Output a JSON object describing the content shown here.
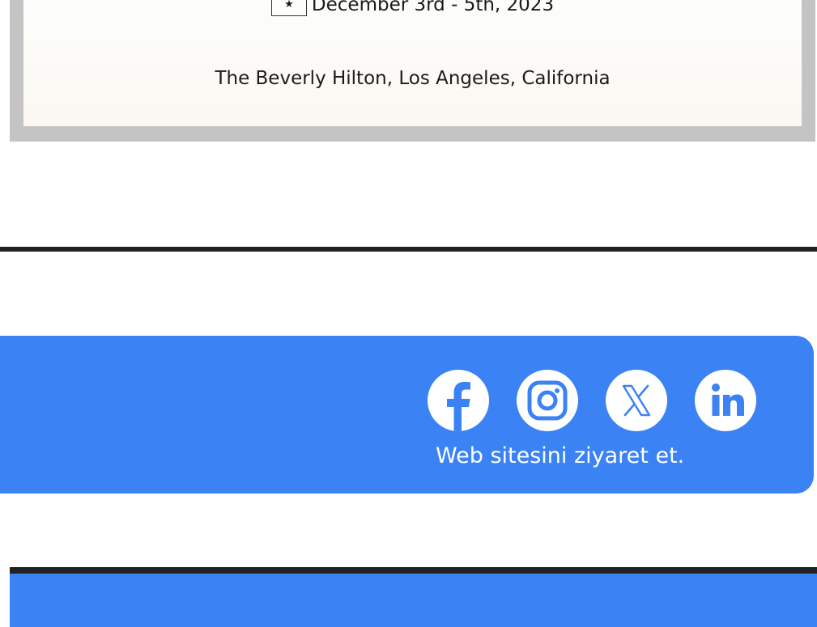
{
  "event": {
    "date_text": "December 3rd - 5th, 2023",
    "venue_text": "The Beverly Hilton, Los Angeles, California",
    "star_glyph": "★"
  },
  "social": {
    "icons": [
      "facebook-icon",
      "instagram-icon",
      "x-icon",
      "linkedin-icon"
    ],
    "visit_label": "Web sitesini ziyaret et."
  },
  "colors": {
    "accent_blue": "#3b82f4",
    "divider": "#222222",
    "frame_gray": "#c4c4c4"
  }
}
